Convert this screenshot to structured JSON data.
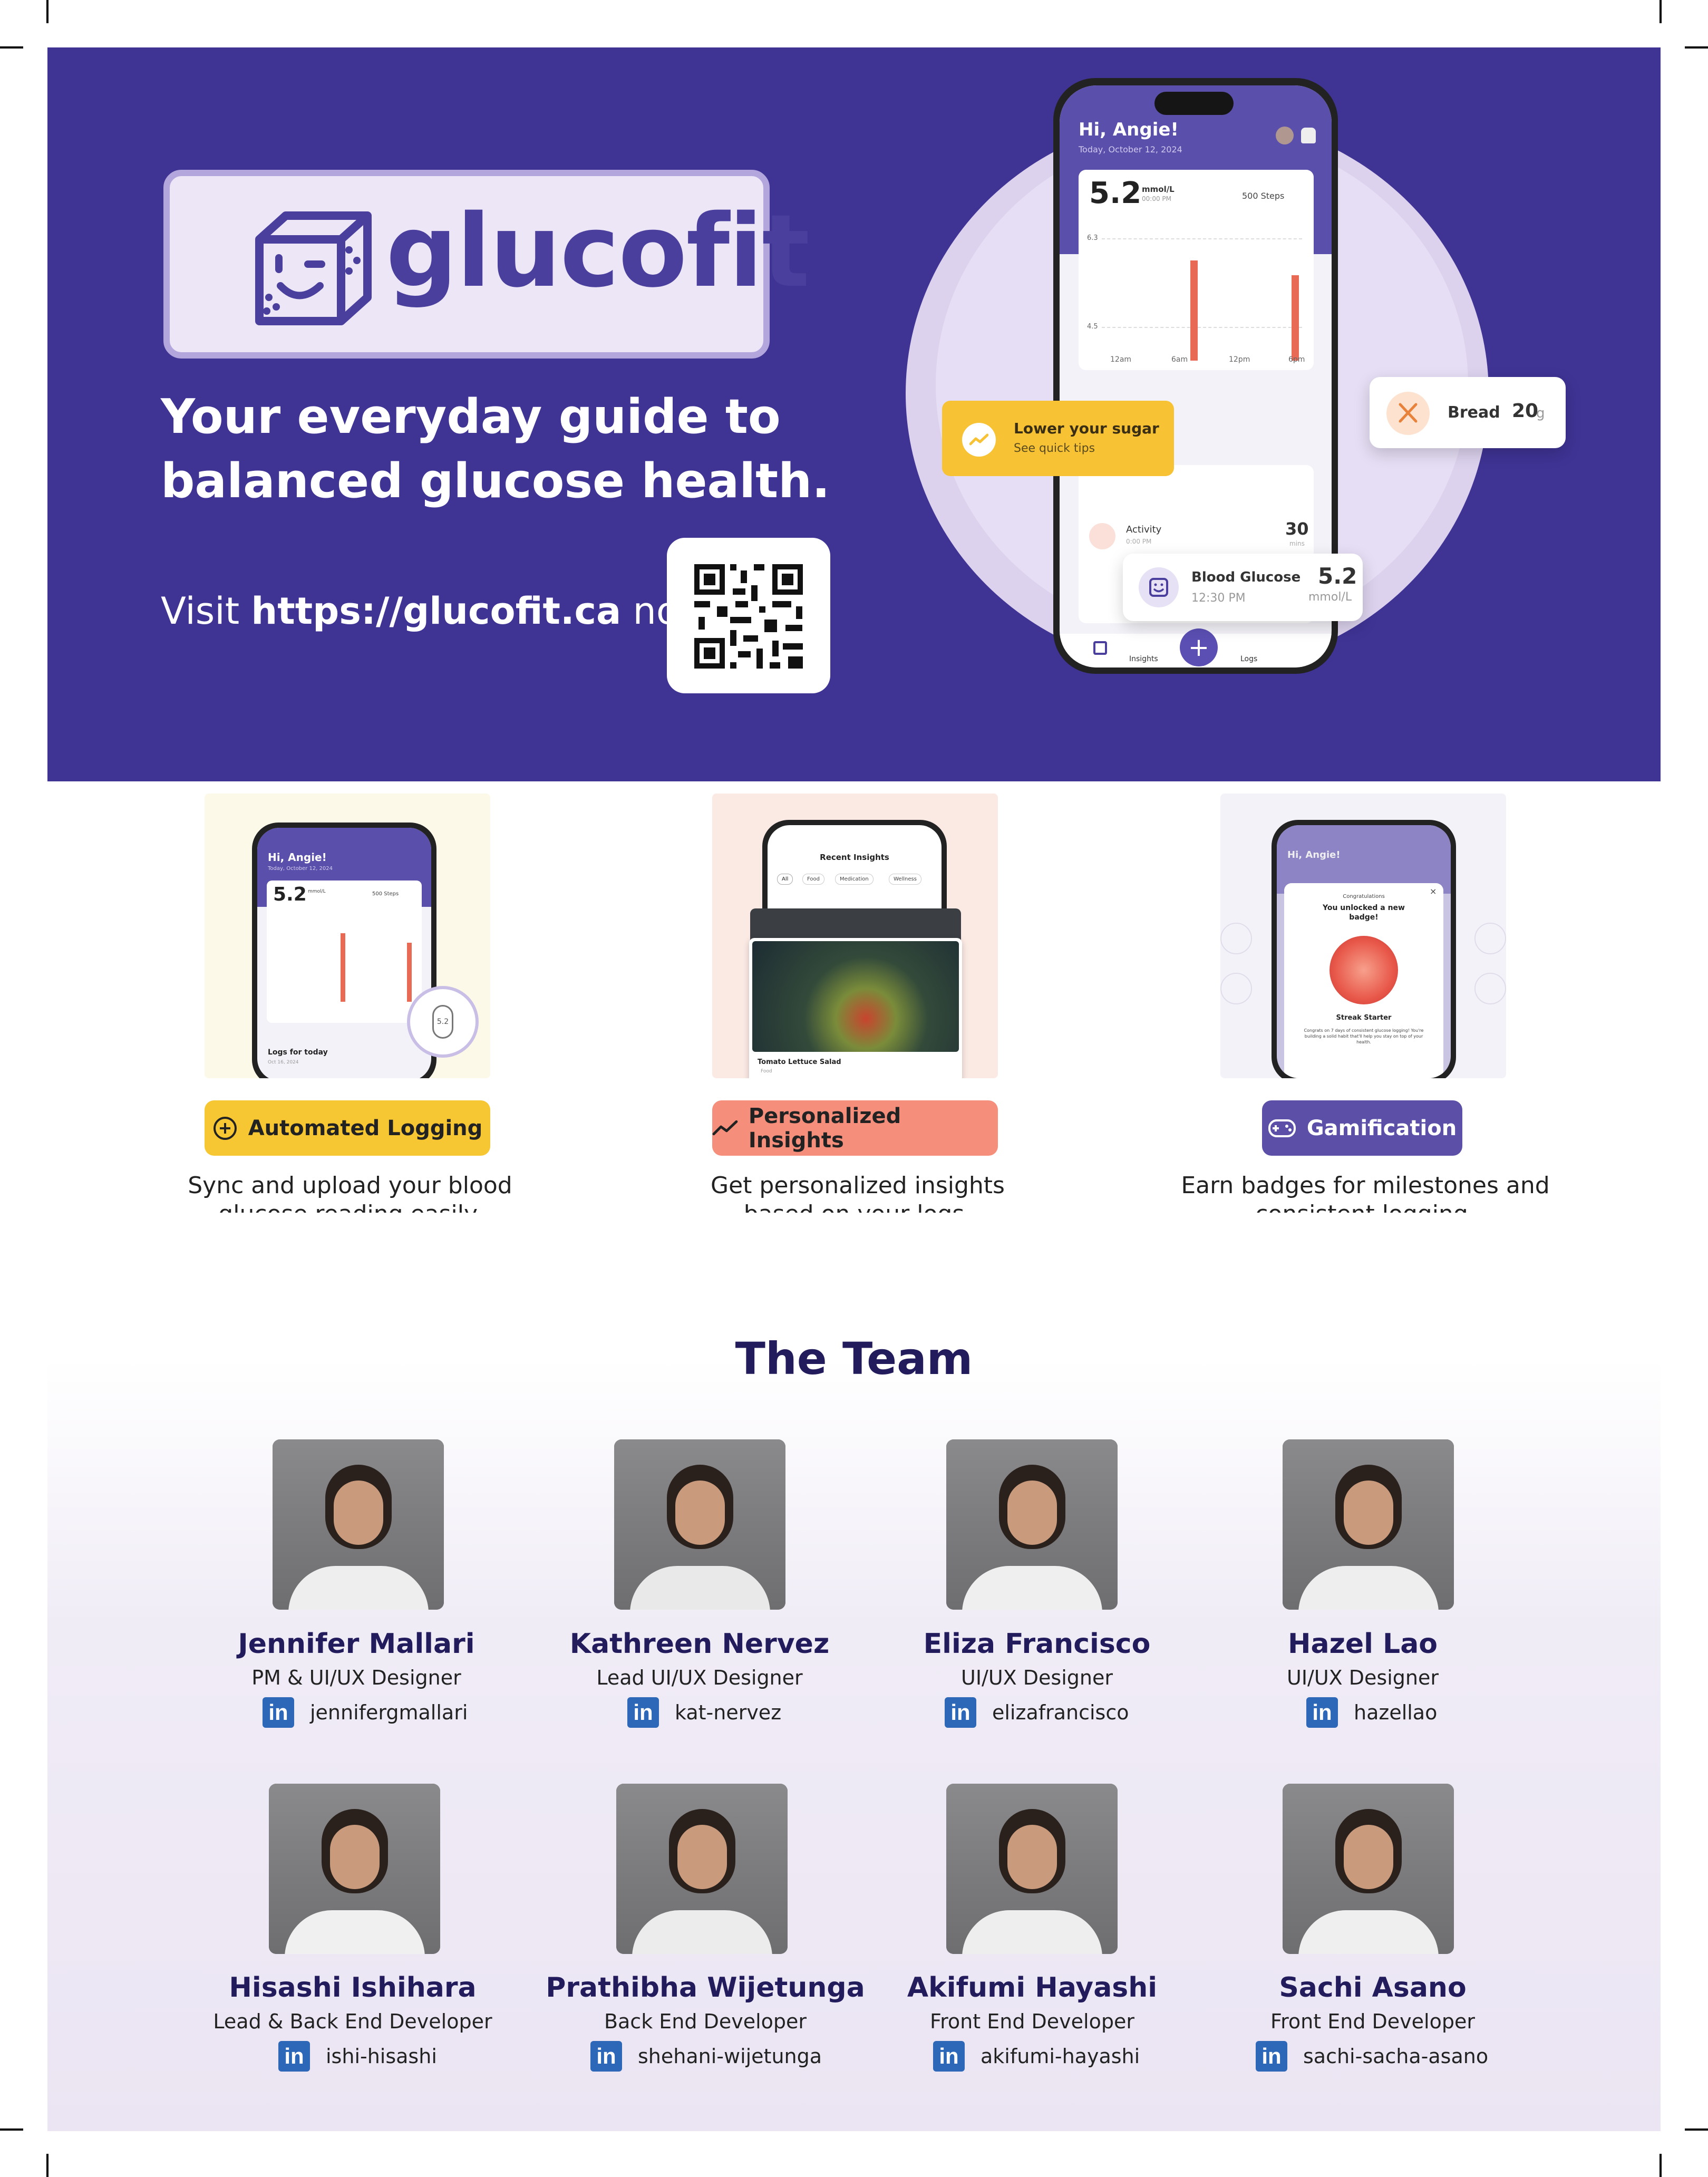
{
  "hero": {
    "logo_text": "glucofit",
    "tagline": "Your everyday guide to balanced glucose health.",
    "visit_prefix": "Visit ",
    "visit_url": "https://glucofit.ca",
    "visit_suffix": " now!"
  },
  "phone_mock": {
    "greeting": "Hi, Angie!",
    "date": "Today, October 12, 2024",
    "reading": "5.2",
    "reading_unit": "mmol/L",
    "reading_time": "00:00 PM",
    "steps": "500 Steps",
    "y_ticks": [
      "6.3",
      "4.5"
    ],
    "x_ticks": [
      "12am",
      "6am",
      "12pm",
      "6pm"
    ],
    "activity_label": "Activity",
    "activity_time": "0:00 PM",
    "activity_value": "30",
    "activity_unit": "mins",
    "nav": [
      "Insights",
      "Logs"
    ],
    "tip_title": "Lower your sugar",
    "tip_sub": "See quick tips",
    "bread_label": "Bread",
    "bread_value": "20",
    "bread_unit": "g",
    "bg_label": "Blood Glucose",
    "bg_time": "12:30 PM",
    "bg_value": "5.2",
    "bg_unit": "mmol/L"
  },
  "features": [
    {
      "label": "Automated Logging",
      "desc": "Sync and upload your blood glucose reading easily.",
      "bg": "#fdf9e8",
      "pill_color": "#f7c733",
      "text_color": "#222222",
      "mock_greeting": "Hi, Angie!",
      "mock_date": "Today, October 12, 2024",
      "mock_reading": "5.2",
      "mock_unit": "mmol/L",
      "mock_steps": "500 Steps",
      "mock_footer": "Logs for today",
      "mock_footer_date": "Oct 16, 2024",
      "mock_badge": "5.2"
    },
    {
      "label": "Personalized Insights",
      "desc": "Get personalized insights based on your logs.",
      "bg": "#fbe9e4",
      "pill_color": "#f58e7a",
      "text_color": "#222222",
      "mock_title": "Recent Insights",
      "mock_tabs": [
        "All",
        "Food",
        "Medication",
        "Wellness"
      ],
      "mock_caption": "Tomato Lettuce Salad",
      "mock_caption_sub": "Food"
    },
    {
      "label": "Gamification",
      "desc": "Earn badges for milestones and consistent logging.",
      "bg": "#f4f2f9",
      "pill_color": "#5b4fa8",
      "text_color": "#ffffff",
      "mock_greeting": "Hi, Angie!",
      "mock_congrats": "Congratulations",
      "mock_unlock": "You unlocked a new badge!",
      "mock_badge_name": "Streak Starter",
      "mock_badge_text": "Congrats on 7 days of consistent glucose logging! You're building a solid habit that'll help you stay on top of your health."
    }
  ],
  "team": {
    "title": "The Team",
    "members": [
      {
        "name": "Jennifer Mallari",
        "role": "PM & UI/UX Designer",
        "handle": "jennifergmallari"
      },
      {
        "name": "Kathreen Nervez",
        "role": "Lead UI/UX Designer",
        "handle": "kat-nervez"
      },
      {
        "name": "Eliza Francisco",
        "role": "UI/UX Designer",
        "handle": "elizafrancisco"
      },
      {
        "name": "Hazel Lao",
        "role": "UI/UX Designer",
        "handle": "hazellao"
      },
      {
        "name": "Hisashi Ishihara",
        "role": "Lead & Back End Developer",
        "handle": "ishi-hisashi"
      },
      {
        "name": "Prathibha Wijetunga",
        "role": "Back End Developer",
        "handle": "shehani-wijetunga"
      },
      {
        "name": "Akifumi Hayashi",
        "role": "Front End Developer",
        "handle": "akifumi-hayashi"
      },
      {
        "name": "Sachi Asano",
        "role": "Front End Developer",
        "handle": "sachi-sacha-asano"
      }
    ],
    "linkedin_glyph": "in"
  },
  "colors": {
    "hero_bg": "#3f3394",
    "brand_purple": "#4a3f9c",
    "accent_yellow": "#f7c233",
    "accent_coral": "#e86a55",
    "title_navy": "#231c5c"
  }
}
